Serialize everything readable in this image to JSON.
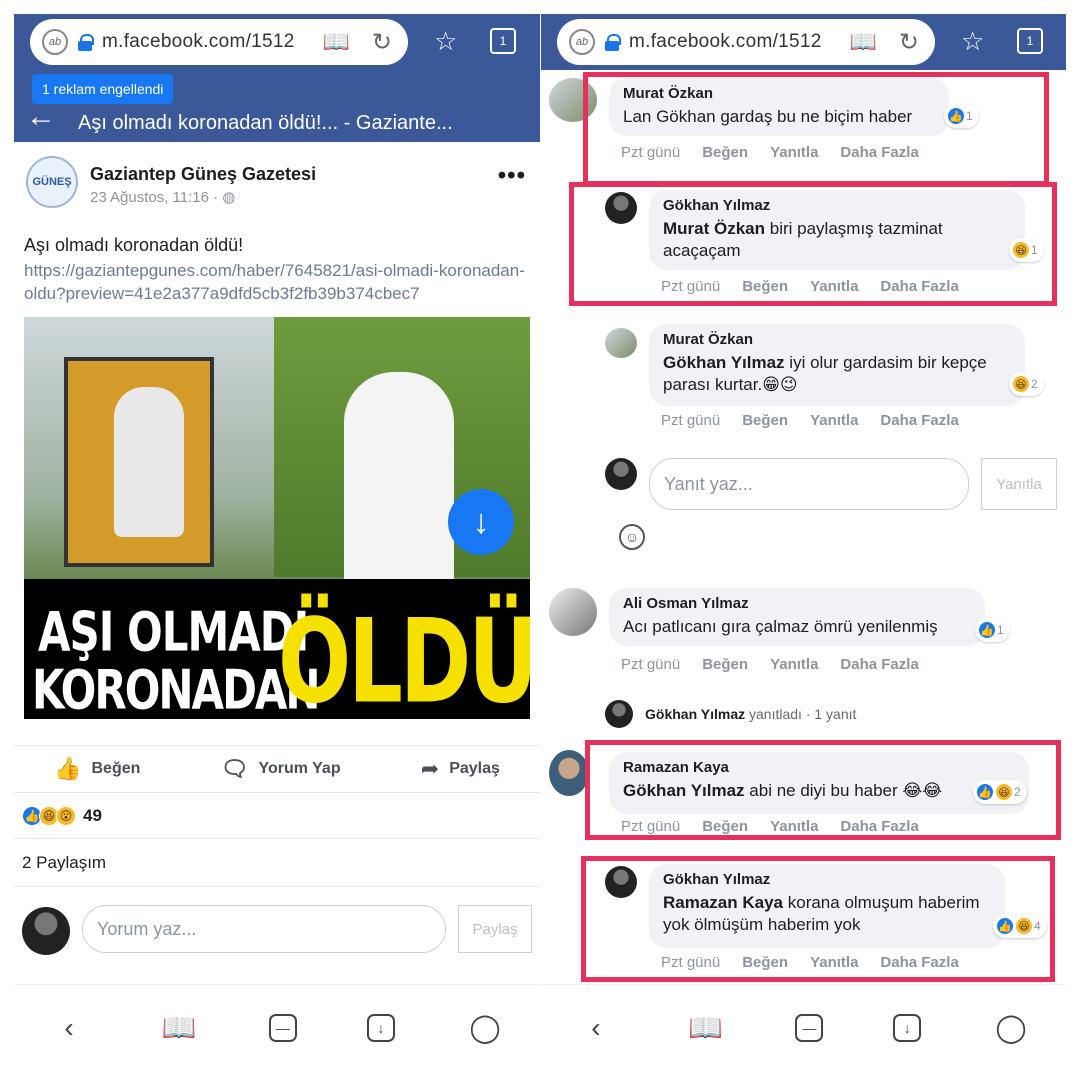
{
  "browser": {
    "url": "m.facebook.com/1512",
    "tab_count": "1"
  },
  "left": {
    "ad_blocked": "1 reklam engellendi",
    "page_title": "Aşı olmadı koronadan öldü!... - Gaziante...",
    "post": {
      "page_name": "Gaziantep Güneş Gazetesi",
      "logo_text": "GÜNEŞ",
      "meta": "23 Ağustos, 11:16 · ◍",
      "text": "Aşı olmadı koronadan öldü!",
      "link": "https://gaziantepgunes.com/haber/7645821/asi-olmadi-koronadan-oldu?preview=41e2a377a9dfd5cb3f2fb39b374cbec7",
      "image_headline_1": "AŞI OLMADI",
      "image_headline_2": "KORONADAN",
      "image_headline_3": "ÖLDÜ"
    },
    "actions": {
      "like": "Beğen",
      "comment": "Yorum Yap",
      "share": "Paylaş"
    },
    "reaction_count": "49",
    "shares": "2 Paylaşım",
    "compose": {
      "placeholder": "Yorum yaz...",
      "button": "Paylaş"
    }
  },
  "right": {
    "action_labels": {
      "time": "Pzt günü",
      "like": "Beğen",
      "reply": "Yanıtla",
      "more": "Daha Fazla"
    },
    "comments": [
      {
        "name": "Murat Özkan",
        "text": "Lan Gökhan gardaş bu ne biçim haber",
        "reactions": "1"
      },
      {
        "name": "Gökhan Yılmaz",
        "mention": "Murat Özkan",
        "text": " biri paylaşmış tazminat acaçaçam",
        "reactions": "1"
      },
      {
        "name": "Murat Özkan",
        "mention": "Gökhan Yılmaz",
        "text": " iyi olur gardasim bir kepçe parası kurtar.😁😉",
        "reactions": "2"
      },
      {
        "name": "Ali Osman Yılmaz",
        "text": "Acı patlıcanı gıra çalmaz ömrü yenilenmiş",
        "reactions": "1"
      },
      {
        "name": "Ramazan Kaya",
        "mention": "Gökhan Yılmaz",
        "text": " abi ne diyi bu haber 😂😂",
        "reactions": "2"
      },
      {
        "name": "Gökhan Yılmaz",
        "mention": "Ramazan Kaya",
        "text": " korana olmuşum haberim yok ölmüşüm haberim yok",
        "reactions": "4"
      }
    ],
    "reply_compose": {
      "placeholder": "Yanıt yaz...",
      "button": "Yanıtla"
    },
    "replied_row": {
      "name": "Gökhan Yılmaz",
      "suffix": " yanıtladı",
      "count": " · 1 yanıt"
    }
  },
  "colors": {
    "facebook_blue": "#3b5998",
    "highlight": "#e5315d",
    "like_blue": "#1877f2"
  }
}
